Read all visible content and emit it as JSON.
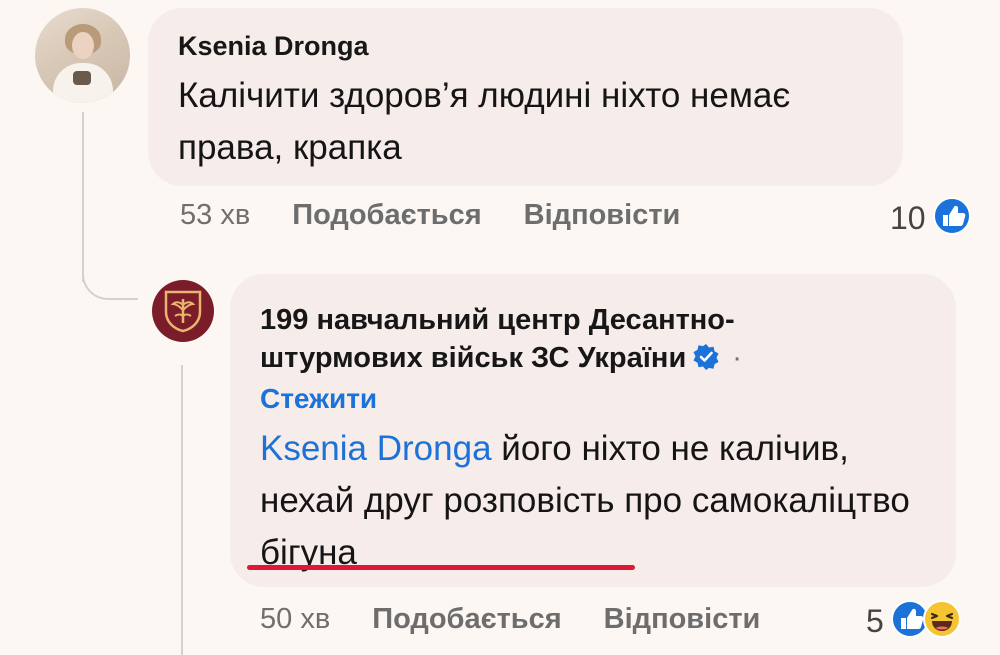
{
  "comments": [
    {
      "author": "Ksenia  Dronga",
      "text": "Калічити здоров’я людині ніхто немає\nправа, крапка",
      "time": "53 хв",
      "like_label": "Подобається",
      "reply_label": "Відповісти",
      "reaction_count": "10",
      "reaction_icons": [
        "like-icon"
      ]
    },
    {
      "author": "199 навчальний центр Десантно-штурмових військ ЗС України",
      "verified": true,
      "separator": "·",
      "follow_label": "Стежити",
      "mention": "Ksenia  Dronga",
      "text_rest": " його ніхто не калічив, нехай друг розповість про ",
      "text_highlight": "самокаліцтво бігуна",
      "time": "50 хв",
      "like_label": "Подобається",
      "reply_label": "Відповісти",
      "reaction_count": "5",
      "reaction_icons": [
        "like-icon",
        "haha-icon"
      ]
    }
  ],
  "colors": {
    "page_background": "#fdf7f3",
    "bubble_background": "#f6ecea",
    "link_blue": "#1b72d8",
    "highlight_underline": "#e01837",
    "unit_avatar": "#7b1c2b"
  }
}
